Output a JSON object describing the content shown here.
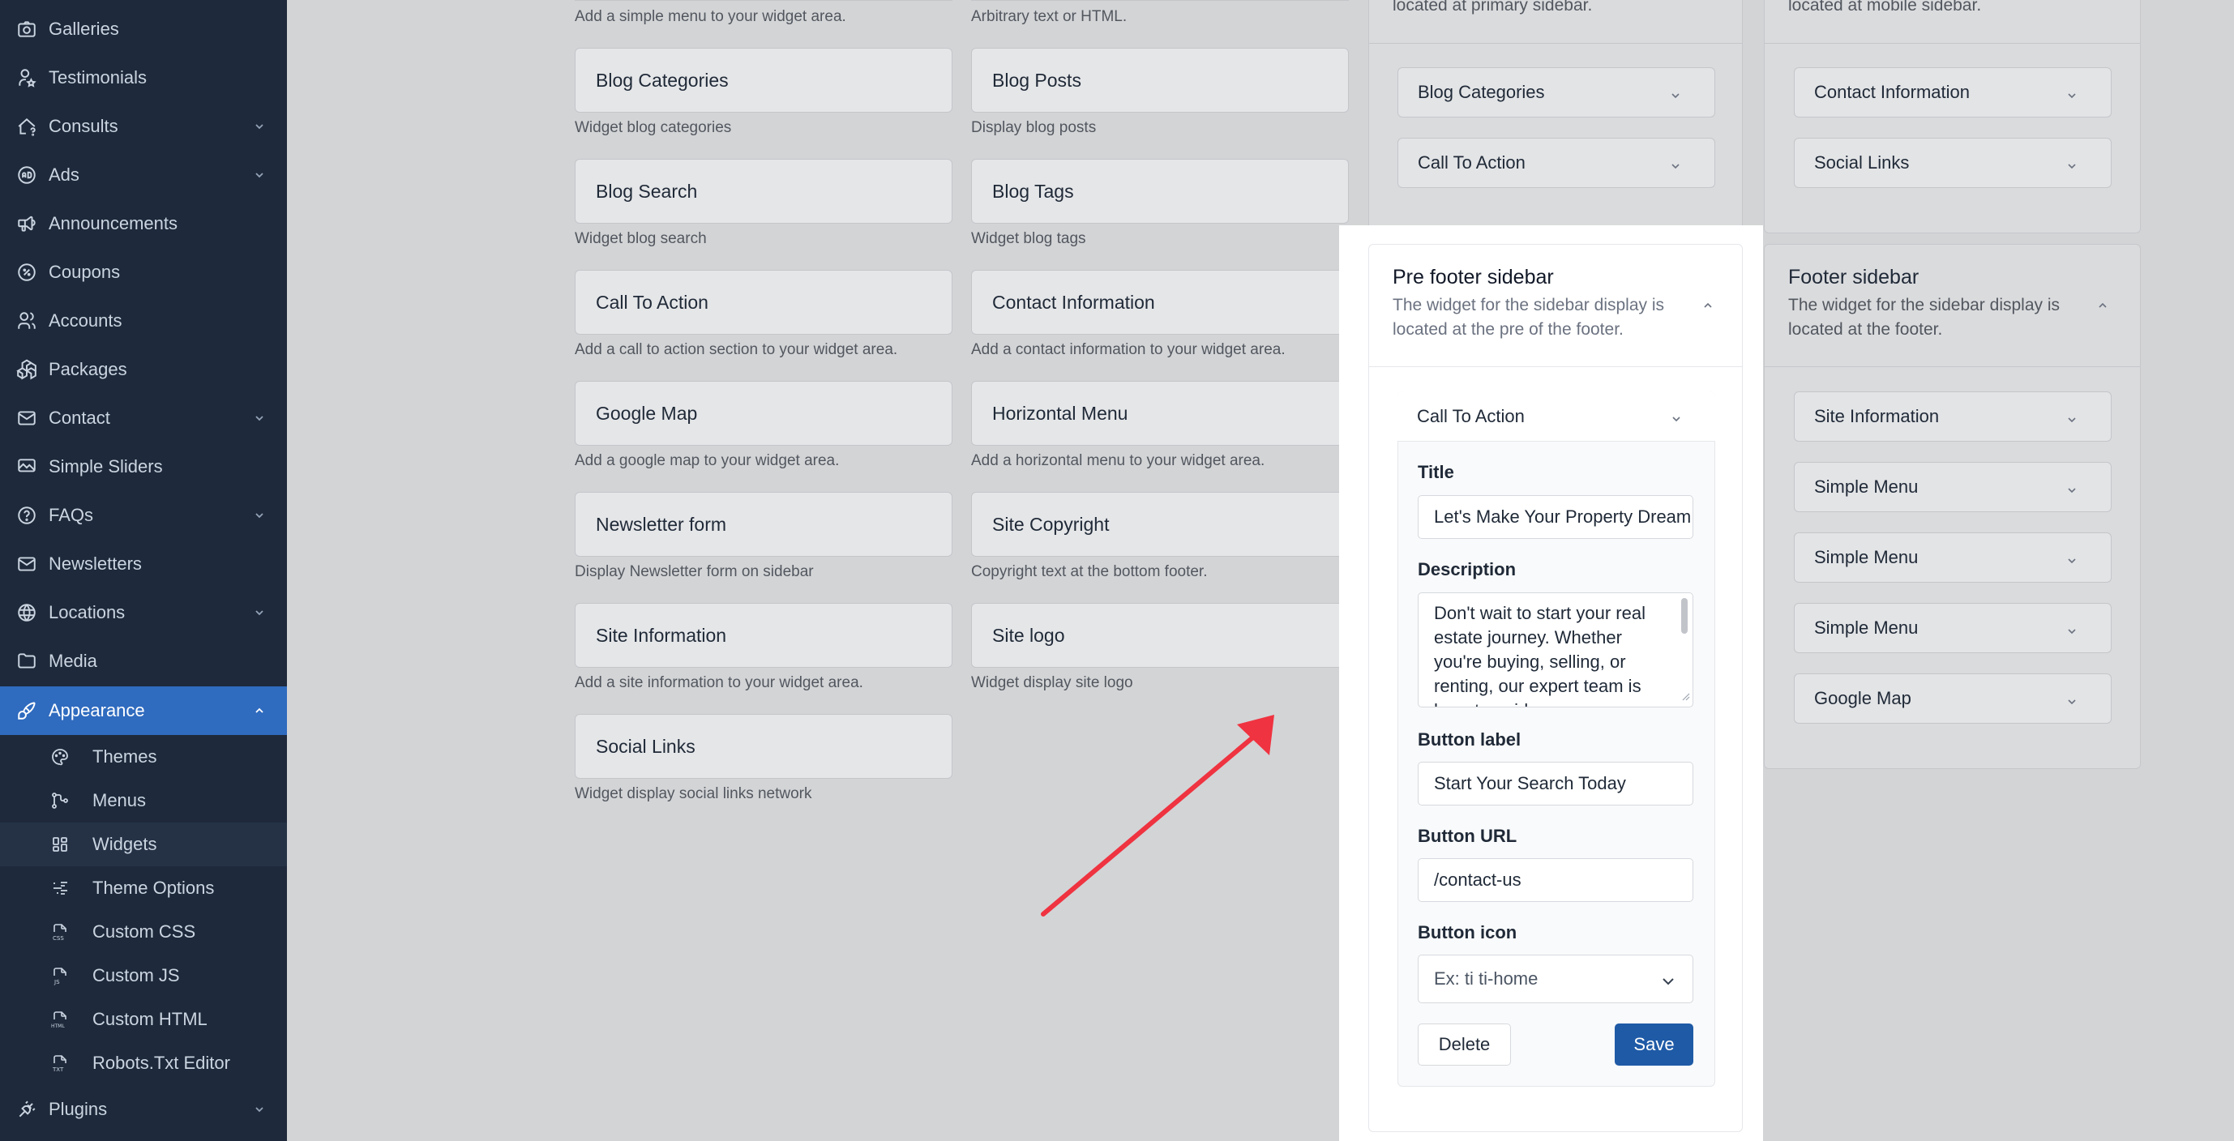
{
  "sidebar": {
    "items": [
      {
        "label": "Galleries",
        "icon": "camera-icon",
        "has_children": false
      },
      {
        "label": "Testimonials",
        "icon": "user-star-icon",
        "has_children": false
      },
      {
        "label": "Consults",
        "icon": "home-question-icon",
        "has_children": true
      },
      {
        "label": "Ads",
        "icon": "ad-circle-icon",
        "has_children": true
      },
      {
        "label": "Announcements",
        "icon": "speakerphone-icon",
        "has_children": false
      },
      {
        "label": "Coupons",
        "icon": "discount-icon",
        "has_children": false
      },
      {
        "label": "Accounts",
        "icon": "users-icon",
        "has_children": false
      },
      {
        "label": "Packages",
        "icon": "packages-icon",
        "has_children": false
      },
      {
        "label": "Contact",
        "icon": "mail-icon",
        "has_children": true
      },
      {
        "label": "Simple Sliders",
        "icon": "slideshow-icon",
        "has_children": false
      },
      {
        "label": "FAQs",
        "icon": "help-circle-icon",
        "has_children": true
      },
      {
        "label": "Newsletters",
        "icon": "mail-icon",
        "has_children": false
      },
      {
        "label": "Locations",
        "icon": "world-icon",
        "has_children": true
      },
      {
        "label": "Media",
        "icon": "folder-icon",
        "has_children": false
      },
      {
        "label": "Appearance",
        "icon": "brush-icon",
        "has_children": true,
        "active": true
      },
      {
        "label": "Plugins",
        "icon": "plug-icon",
        "has_children": true
      }
    ],
    "appearance_children": [
      {
        "label": "Themes",
        "icon": "palette-icon"
      },
      {
        "label": "Menus",
        "icon": "hierarchy-icon"
      },
      {
        "label": "Widgets",
        "icon": "layout-icon",
        "current": true
      },
      {
        "label": "Theme Options",
        "icon": "list-details-icon"
      },
      {
        "label": "Custom CSS",
        "icon": "file-type-css-icon"
      },
      {
        "label": "Custom JS",
        "icon": "file-type-js-icon"
      },
      {
        "label": "Custom HTML",
        "icon": "file-type-html-icon"
      },
      {
        "label": "Robots.Txt Editor",
        "icon": "file-type-txt-icon"
      }
    ]
  },
  "available_widgets": {
    "top_descriptions": [
      "Add a simple menu to your widget area.",
      "Arbitrary text or HTML."
    ],
    "items": [
      {
        "name": "Blog Categories",
        "description": "Widget blog categories"
      },
      {
        "name": "Blog Posts",
        "description": "Display blog posts"
      },
      {
        "name": "Blog Search",
        "description": "Widget blog search"
      },
      {
        "name": "Blog Tags",
        "description": "Widget blog tags"
      },
      {
        "name": "Call To Action",
        "description": "Add a call to action section to your widget area."
      },
      {
        "name": "Contact Information",
        "description": "Add a contact information to your widget area."
      },
      {
        "name": "Google Map",
        "description": "Add a google map to your widget area."
      },
      {
        "name": "Horizontal Menu",
        "description": "Add a horizontal menu to your widget area."
      },
      {
        "name": "Newsletter form",
        "description": "Display Newsletter form on sidebar"
      },
      {
        "name": "Site Copyright",
        "description": "Copyright text at the bottom footer."
      },
      {
        "name": "Site Information",
        "description": "Add a site information to your widget area."
      },
      {
        "name": "Site logo",
        "description": "Widget display site logo"
      },
      {
        "name": "Social Links",
        "description": "Widget display social links network"
      }
    ]
  },
  "primary_sidebar": {
    "desc_tail": "located at primary sidebar.",
    "items": [
      "Blog Categories",
      "Call To Action"
    ]
  },
  "mobile_sidebar": {
    "desc_tail": "located at mobile sidebar.",
    "items": [
      "Contact Information",
      "Social Links"
    ]
  },
  "pre_footer_sidebar": {
    "title": "Pre footer sidebar",
    "description": "The widget for the sidebar display is located at the pre of the footer.",
    "open_widget": {
      "name": "Call To Action",
      "fields": {
        "title_label": "Title",
        "title_value": "Let's Make Your Property Dream",
        "description_label": "Description",
        "description_value": "Don't wait to start your real estate journey. Whether you're buying, selling, or renting, our expert team is here to guide you",
        "button_label_label": "Button label",
        "button_label_value": "Start Your Search Today",
        "button_url_label": "Button URL",
        "button_url_value": "/contact-us",
        "button_icon_label": "Button icon",
        "button_icon_placeholder": "Ex: ti ti-home"
      },
      "delete_label": "Delete",
      "save_label": "Save"
    }
  },
  "footer_sidebar": {
    "title": "Footer sidebar",
    "description": "The widget for the sidebar display is located at the footer.",
    "items": [
      "Site Information",
      "Simple Menu",
      "Simple Menu",
      "Simple Menu",
      "Google Map"
    ]
  },
  "colors": {
    "sidebar_bg": "#1e293b",
    "active_nav": "#2f6bbf",
    "overlay_bg": "#d3d4d6",
    "save_button": "#1f5aa6",
    "arrow": "#ef3340"
  }
}
